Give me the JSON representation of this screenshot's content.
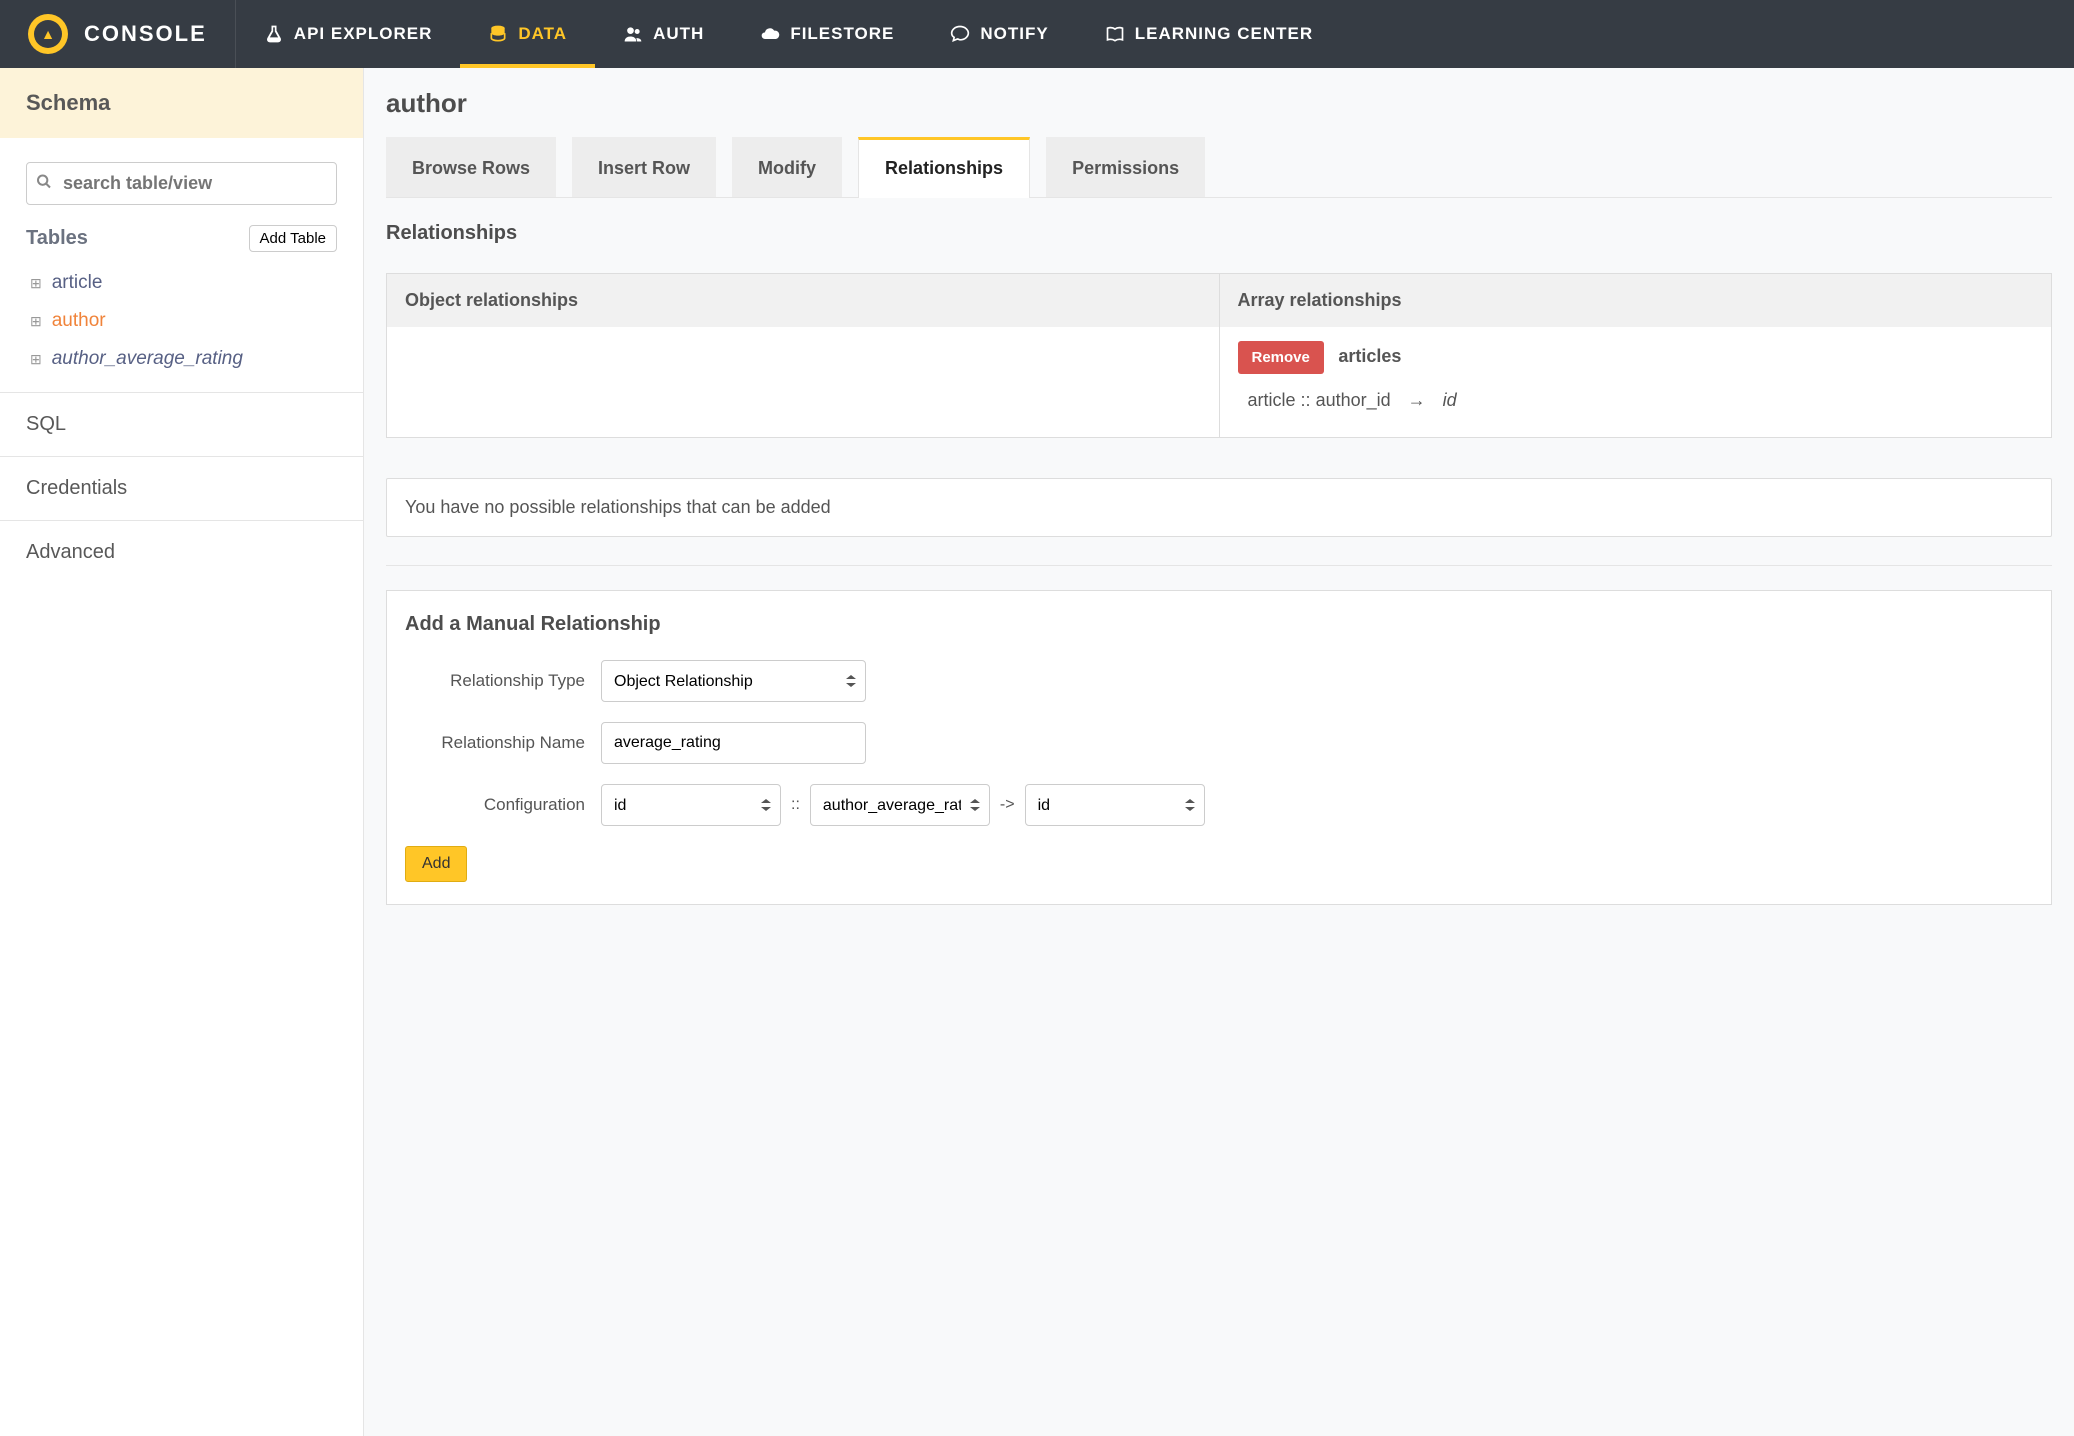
{
  "brand": {
    "name": "CONSOLE"
  },
  "nav": {
    "items": [
      {
        "key": "api-explorer",
        "label": "API EXPLORER"
      },
      {
        "key": "data",
        "label": "DATA"
      },
      {
        "key": "auth",
        "label": "AUTH"
      },
      {
        "key": "filestore",
        "label": "FILESTORE"
      },
      {
        "key": "notify",
        "label": "NOTIFY"
      },
      {
        "key": "learning-center",
        "label": "LEARNING CENTER"
      }
    ],
    "active": "data"
  },
  "sidebar": {
    "schema_header": "Schema",
    "search_placeholder": "search table/view",
    "tables_label": "Tables",
    "add_table_label": "Add Table",
    "tables": [
      {
        "name": "article",
        "active": false,
        "italic": false
      },
      {
        "name": "author",
        "active": true,
        "italic": false
      },
      {
        "name": "author_average_rating",
        "active": false,
        "italic": true
      }
    ],
    "sections": [
      {
        "key": "sql",
        "label": "SQL"
      },
      {
        "key": "credentials",
        "label": "Credentials"
      },
      {
        "key": "advanced",
        "label": "Advanced"
      }
    ]
  },
  "main": {
    "page_title": "author",
    "tabs": [
      {
        "key": "browse",
        "label": "Browse Rows"
      },
      {
        "key": "insert",
        "label": "Insert Row"
      },
      {
        "key": "modify",
        "label": "Modify"
      },
      {
        "key": "relationships",
        "label": "Relationships"
      },
      {
        "key": "permissions",
        "label": "Permissions"
      }
    ],
    "active_tab": "relationships",
    "relationships": {
      "section_title": "Relationships",
      "object_header": "Object relationships",
      "array_header": "Array relationships",
      "remove_label": "Remove",
      "array_items": [
        {
          "name": "articles",
          "ref_table": "article",
          "ref_column": "author_id",
          "sep_colons": "::",
          "arrow": "→",
          "local_column": "id"
        }
      ],
      "no_possible_text": "You have no possible relationships that can be added"
    },
    "manual": {
      "title": "Add a Manual Relationship",
      "type_label": "Relationship Type",
      "type_value": "Object Relationship",
      "name_label": "Relationship Name",
      "name_value": "average_rating",
      "config_label": "Configuration",
      "config_from": "id",
      "config_sep1": "::",
      "config_table": "author_average_rat",
      "config_sep2": "->",
      "config_to": "id",
      "add_label": "Add"
    }
  }
}
